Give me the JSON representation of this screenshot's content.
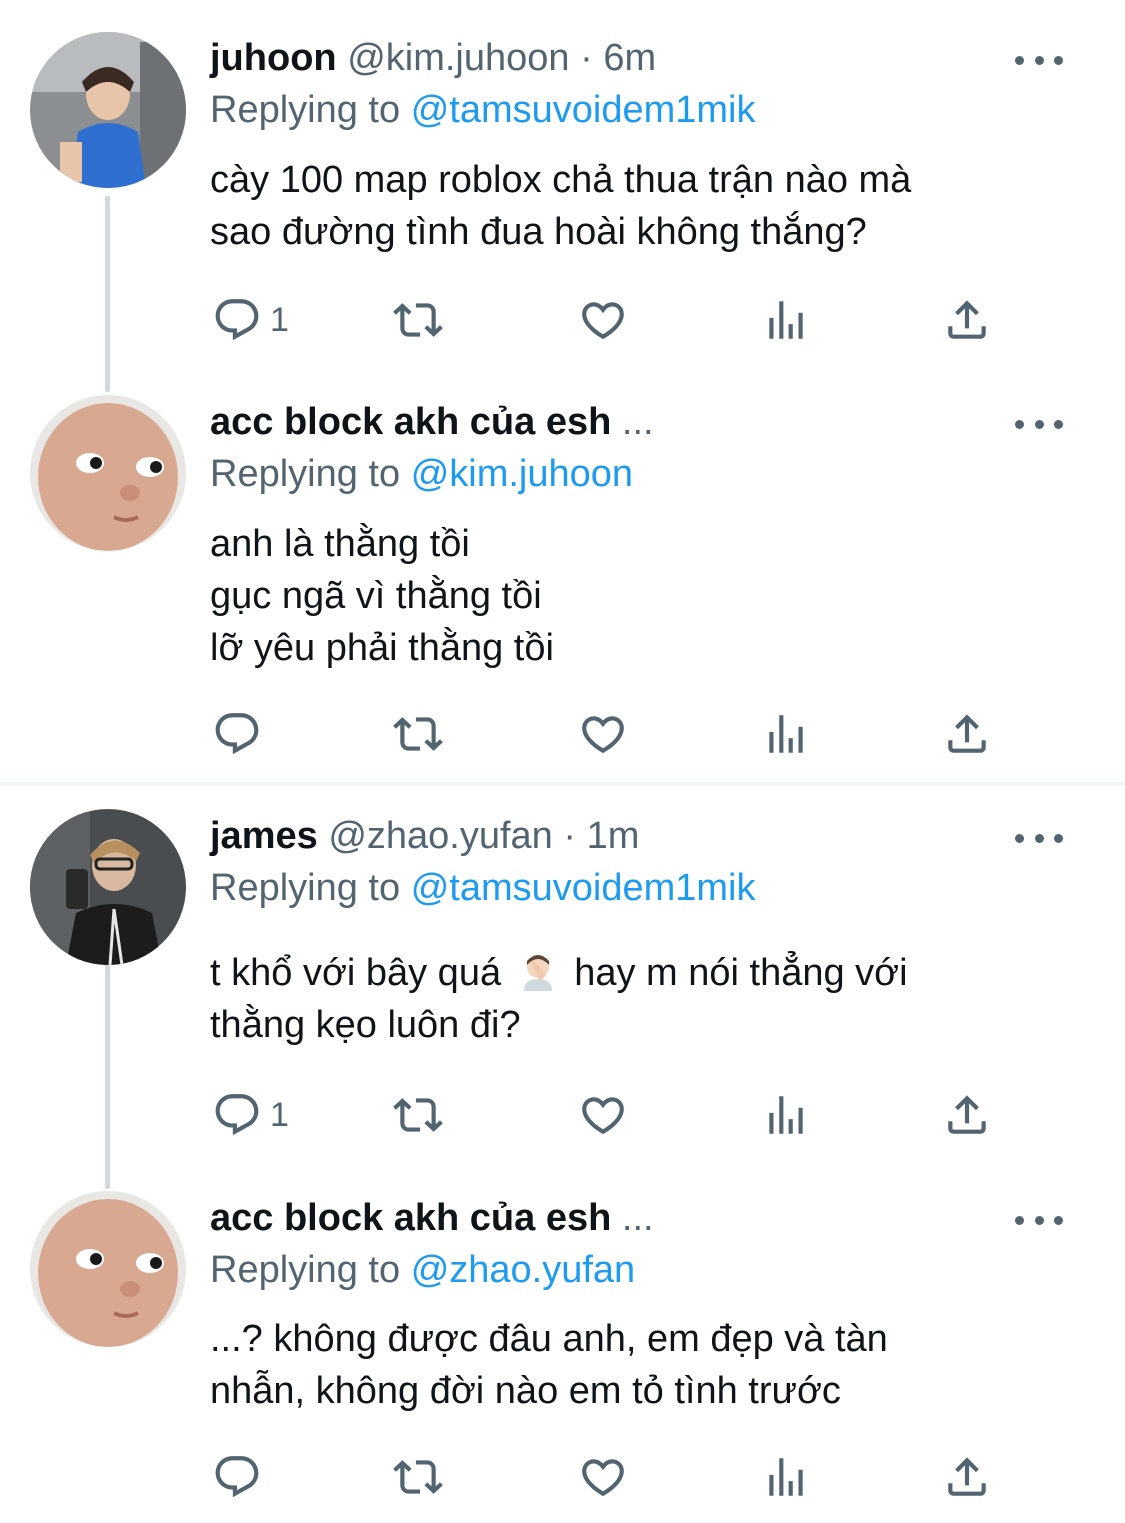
{
  "replying_prefix": "Replying to",
  "tweets": [
    {
      "name": "juhoon",
      "handle": "@kim.juhoon",
      "separator": "·",
      "time": "6m",
      "reply_to": "@tamsuvoidem1mik",
      "lines": [
        "cày 100 map roblox chả thua trận nào mà",
        "sao đường tình đua hoài không thắng?"
      ],
      "reply_count": "1"
    },
    {
      "name": "acc block akh của esh",
      "truncation": "...",
      "reply_to": "@kim.juhoon",
      "lines": [
        "anh là thằng tồi",
        "gục ngã vì thằng tồi",
        "lỡ yêu phải thằng tồi"
      ],
      "reply_count": ""
    },
    {
      "name": "james",
      "handle": "@zhao.yufan",
      "separator": "·",
      "time": "1m",
      "reply_to": "@tamsuvoidem1mik",
      "lines_a": "t khổ với bây quá",
      "emoji": "person-facepalming-emoji",
      "lines_b": "hay m nói thẳng với",
      "line_2": "thằng kẹo luôn đi?",
      "reply_count": "1"
    },
    {
      "name": "acc block akh của esh",
      "truncation": "...",
      "reply_to": "@zhao.yufan",
      "lines": [
        "...? không được đâu anh, em đẹp và tàn",
        "nhẫn, không đời nào em tỏ tình trước"
      ],
      "reply_count": ""
    }
  ],
  "icons": [
    "reply-icon",
    "retweet-icon",
    "like-icon",
    "views-icon",
    "share-icon",
    "more-icon"
  ],
  "colors": {
    "link": "#1d9bf0",
    "muted": "#536471",
    "text": "#0f1419",
    "thread_line": "#cfd9de"
  }
}
